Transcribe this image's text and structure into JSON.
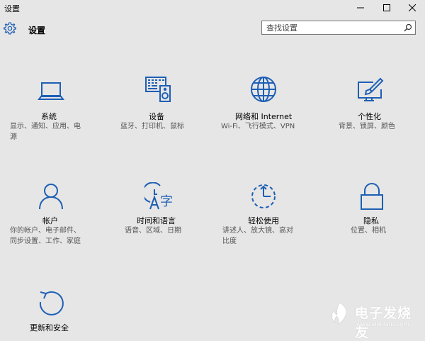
{
  "window": {
    "title": "设置",
    "controls": {
      "minimize": "minimize-icon",
      "maximize": "maximize-icon",
      "close": "close-icon"
    }
  },
  "header": {
    "title": "设置",
    "icon": "gear-icon"
  },
  "search": {
    "placeholder": "查找设置",
    "value": "",
    "icon": "search-icon"
  },
  "categories": [
    {
      "name": "系统",
      "desc": "显示、通知、应用、电\n源",
      "icon": "laptop-icon"
    },
    {
      "name": "设备",
      "desc": "蓝牙、打印机、鼠标",
      "icon": "keyboard-speaker-icon"
    },
    {
      "name": "网络和 Internet",
      "desc": "Wi-Fi、飞行模式、VPN",
      "icon": "globe-icon"
    },
    {
      "name": "个性化",
      "desc": "背景、锁屏、颜色",
      "icon": "paintbrush-monitor-icon"
    },
    {
      "name": "帐户",
      "desc": "你的帐户、电子邮件、\n同步设置、工作、家庭",
      "icon": "person-icon"
    },
    {
      "name": "时间和语言",
      "desc": "语音、区域、日期",
      "icon": "time-language-icon"
    },
    {
      "name": "轻松使用",
      "desc": "讲述人、放大镜、高对\n比度",
      "icon": "ease-of-access-icon"
    },
    {
      "name": "隐私",
      "desc": "位置、相机",
      "icon": "lock-icon"
    },
    {
      "name": "更新和安全",
      "desc": "",
      "icon": "refresh-icon"
    }
  ],
  "watermark": {
    "name": "电子发烧友",
    "url": "www.elecfans.com"
  },
  "colors": {
    "background": "#e6e6e6",
    "accent": "#1e5fb5",
    "text": "#000000",
    "secondary_text": "#555555"
  }
}
